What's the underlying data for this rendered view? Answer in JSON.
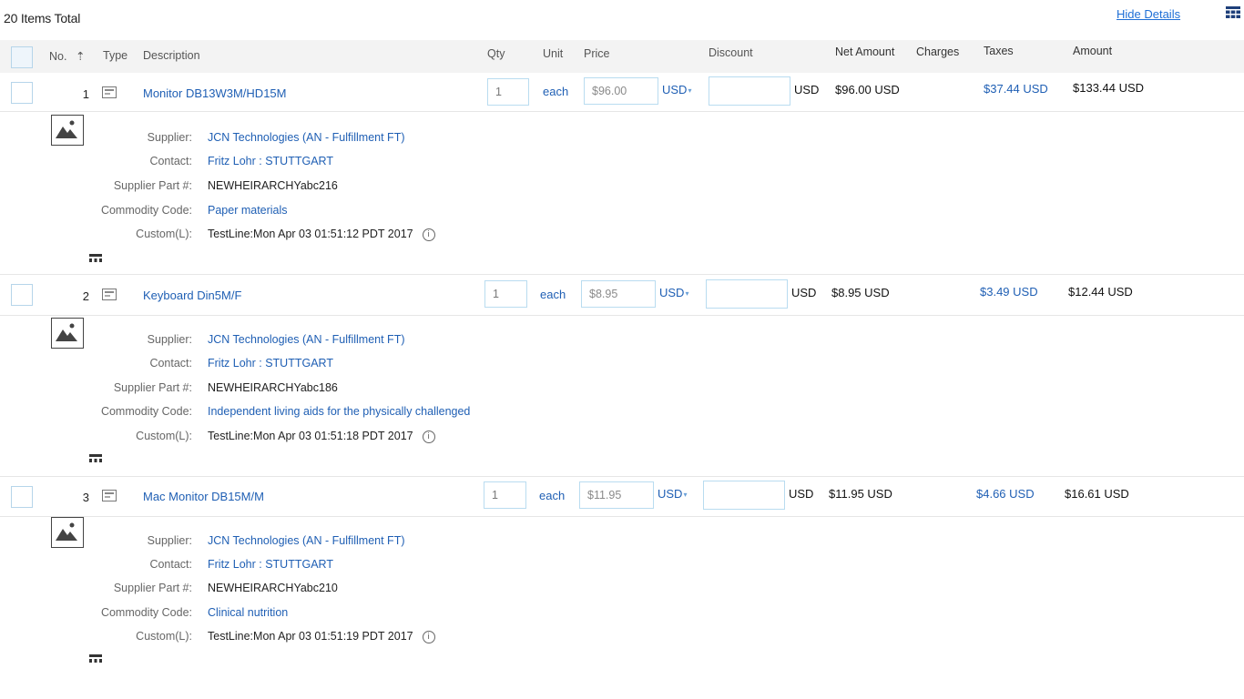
{
  "summary": {
    "total": "20 Items Total"
  },
  "toolbar": {
    "hide_details": "Hide Details",
    "grid_icon": "grid-icon"
  },
  "columns": {
    "no": "No.",
    "sort": "⇡",
    "type": "Type",
    "description": "Description",
    "qty": "Qty",
    "unit": "Unit",
    "price": "Price",
    "discount": "Discount",
    "net_amount": "Net Amount",
    "charges": "Charges",
    "taxes": "Taxes",
    "amount": "Amount"
  },
  "labels": {
    "supplier": "Supplier:",
    "contact": "Contact:",
    "supplier_part": "Supplier Part #:",
    "commodity_code": "Commodity Code:",
    "custom": "Custom(L):"
  },
  "items": [
    {
      "no": "1",
      "description": "Monitor DB13W3M/HD15M",
      "qty": "1",
      "unit": "each",
      "price": "$96.00",
      "currency": "USD",
      "discount": "",
      "discount_currency": "USD",
      "net_amount": "$96.00 USD",
      "charges": "",
      "taxes": "$37.44 USD",
      "amount": "$133.44 USD",
      "supplier": "JCN Technologies (AN - Fulfillment FT)",
      "contact": "Fritz Lohr : STUTTGART",
      "supplier_part": "NEWHEIRARCHYabc216",
      "commodity_code": "Paper materials",
      "custom": "TestLine:Mon Apr 03 01:51:12 PDT 2017"
    },
    {
      "no": "2",
      "description": "Keyboard Din5M/F",
      "qty": "1",
      "unit": "each",
      "price": "$8.95",
      "currency": "USD",
      "discount": "",
      "discount_currency": "USD",
      "net_amount": "$8.95 USD",
      "charges": "",
      "taxes": "$3.49 USD",
      "amount": "$12.44 USD",
      "supplier": "JCN Technologies (AN - Fulfillment FT)",
      "contact": "Fritz Lohr : STUTTGART",
      "supplier_part": "NEWHEIRARCHYabc186",
      "commodity_code": "Independent living aids for the physically challenged",
      "custom": "TestLine:Mon Apr 03 01:51:18 PDT 2017"
    },
    {
      "no": "3",
      "description": "Mac Monitor DB15M/M",
      "qty": "1",
      "unit": "each",
      "price": "$11.95",
      "currency": "USD",
      "discount": "",
      "discount_currency": "USD",
      "net_amount": "$11.95 USD",
      "charges": "",
      "taxes": "$4.66 USD",
      "amount": "$16.61 USD",
      "supplier": "JCN Technologies (AN - Fulfillment FT)",
      "contact": "Fritz Lohr : STUTTGART",
      "supplier_part": "NEWHEIRARCHYabc210",
      "commodity_code": "Clinical nutrition",
      "custom": "TestLine:Mon Apr 03 01:51:19 PDT 2017"
    }
  ],
  "icons": {
    "type": "catalog-item-icon",
    "image": "image-placeholder-icon",
    "info": "info-icon",
    "hierarchy": "hierarchy-icon"
  },
  "colors": {
    "link": "#1f5fb4",
    "input_border": "#b9dcf0",
    "header_bg": "#f3f3f3"
  }
}
